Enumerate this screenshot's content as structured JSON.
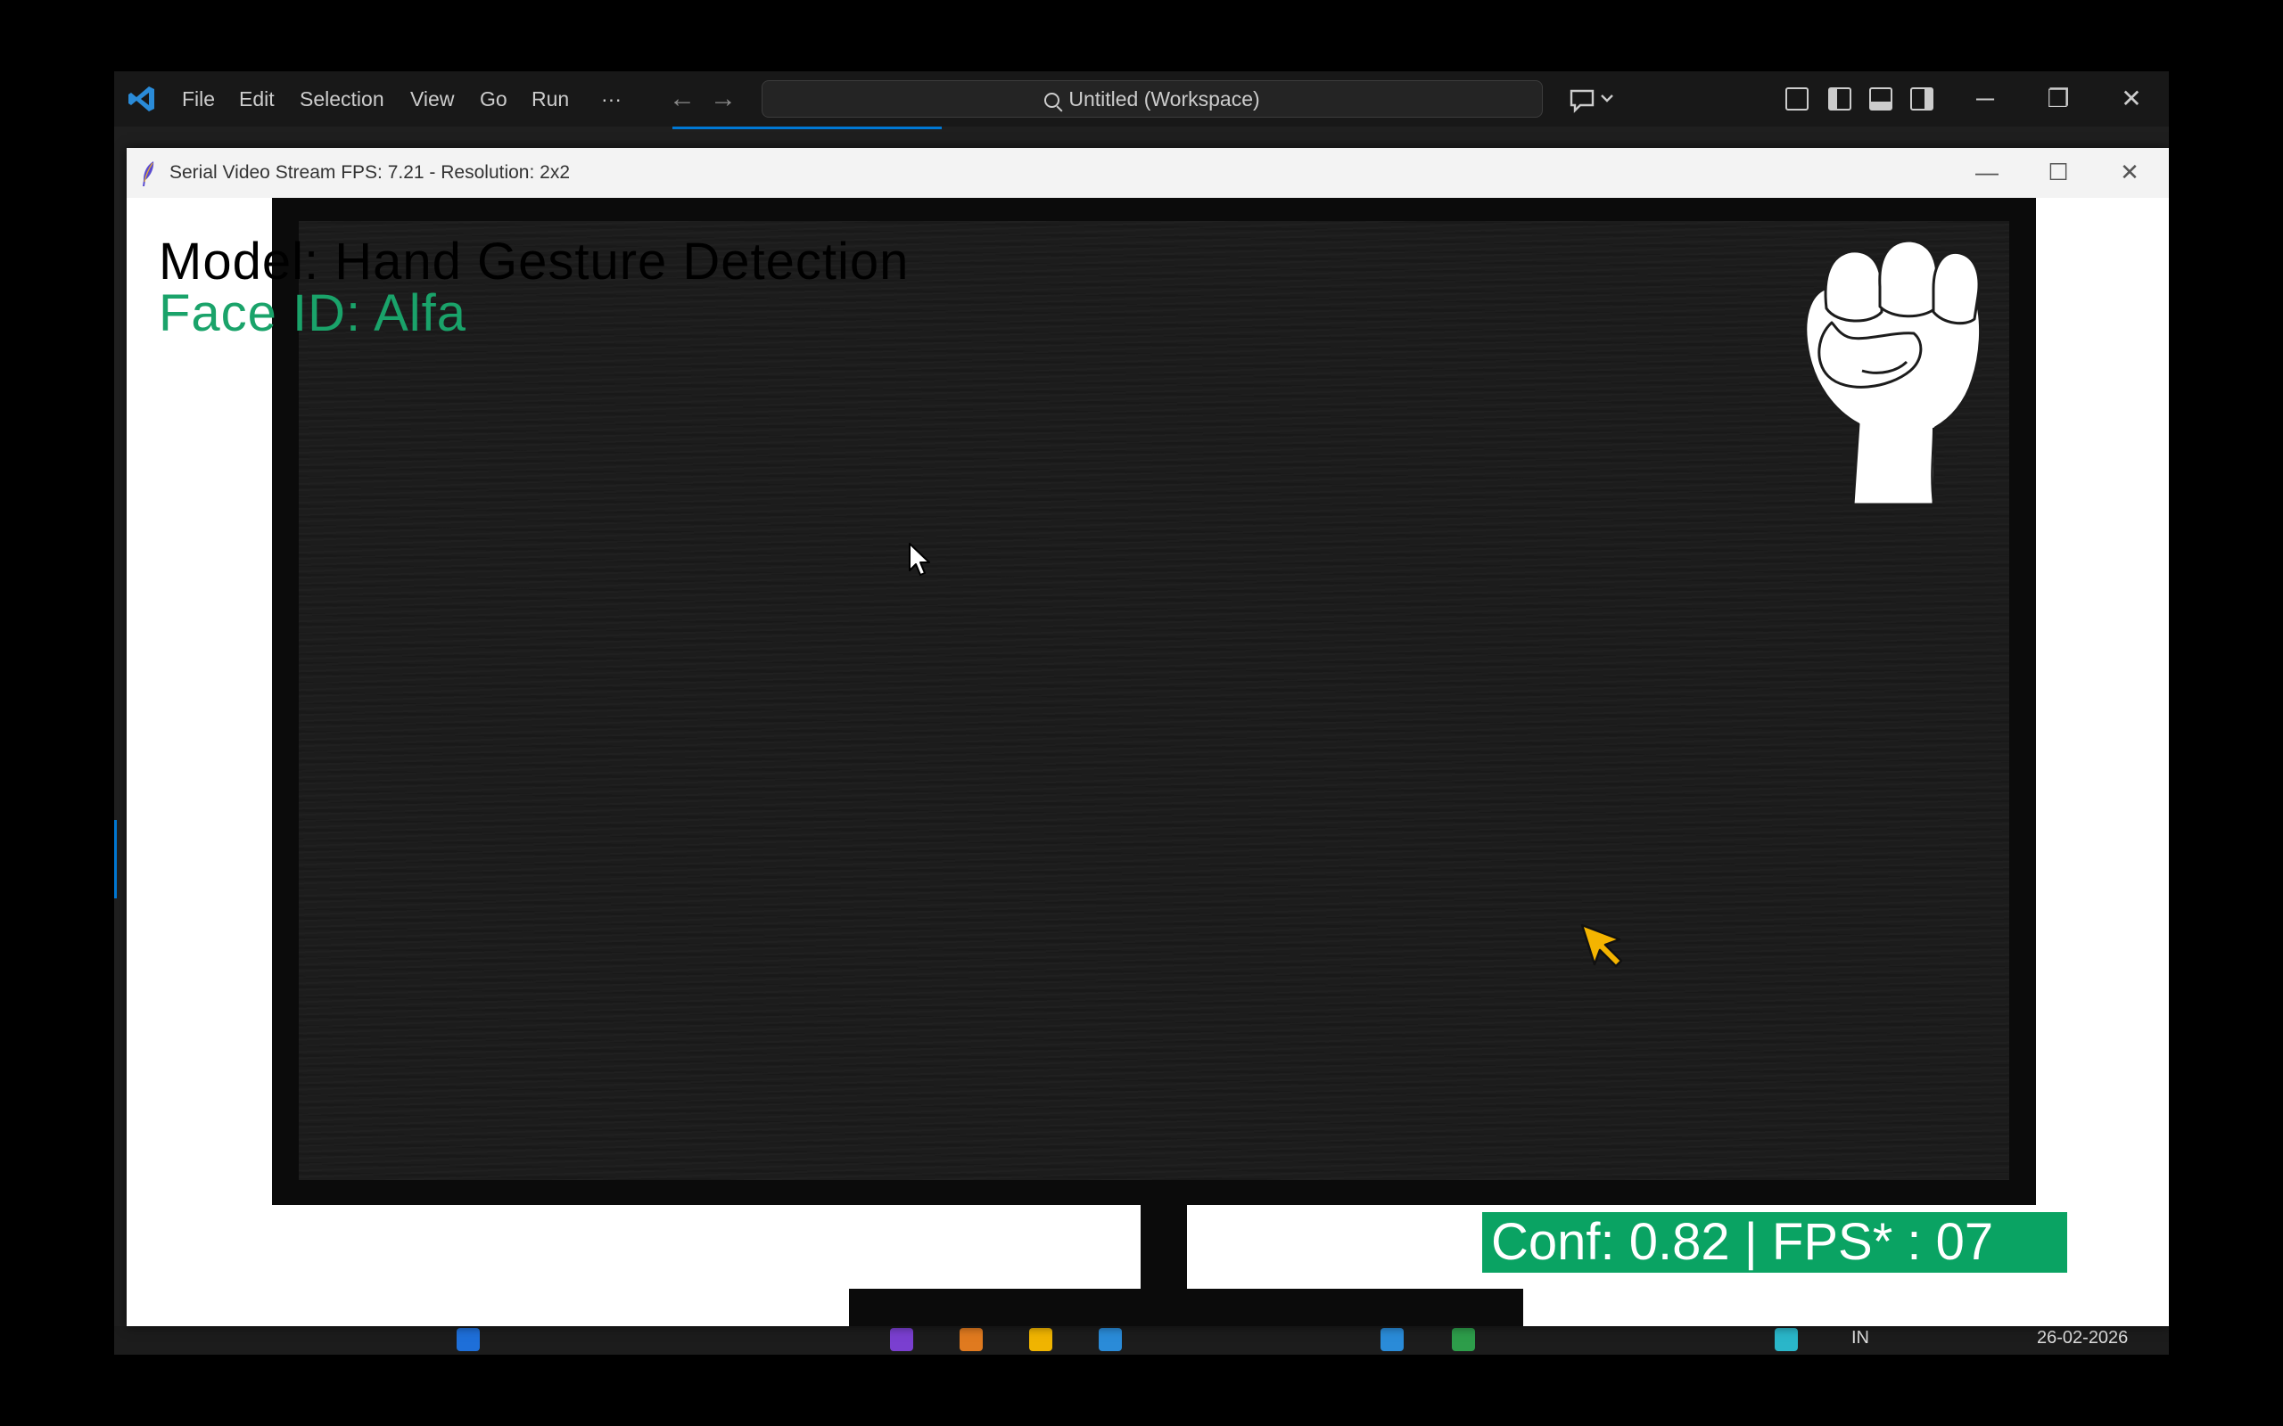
{
  "vscode": {
    "menus": [
      "File",
      "Edit",
      "Selection",
      "View",
      "Go",
      "Run",
      "···"
    ],
    "search_text": "Untitled (Workspace)",
    "accent": "#0078d4"
  },
  "tk_window": {
    "title": "Serial Video Stream FPS: 7.21 - Resolution: 2x2",
    "minimize_glyph": "—",
    "maximize_glyph": "☐",
    "close_glyph": "✕"
  },
  "overlay": {
    "model_text": "Model: Hand Gesture Detection",
    "face_text": "Face ID: Alfa",
    "conf_text": "Conf: 0.82 | FPS* : 07",
    "face_color": "#1aa36a",
    "conf_bg": "#0aa363"
  },
  "icons": {
    "gesture": "fist-icon",
    "cursor_white": "arrow-cursor-icon",
    "cursor_yellow": "yellow-cursor-icon"
  },
  "taskbar": {
    "lang": "IN",
    "date": "26-02-2026"
  }
}
